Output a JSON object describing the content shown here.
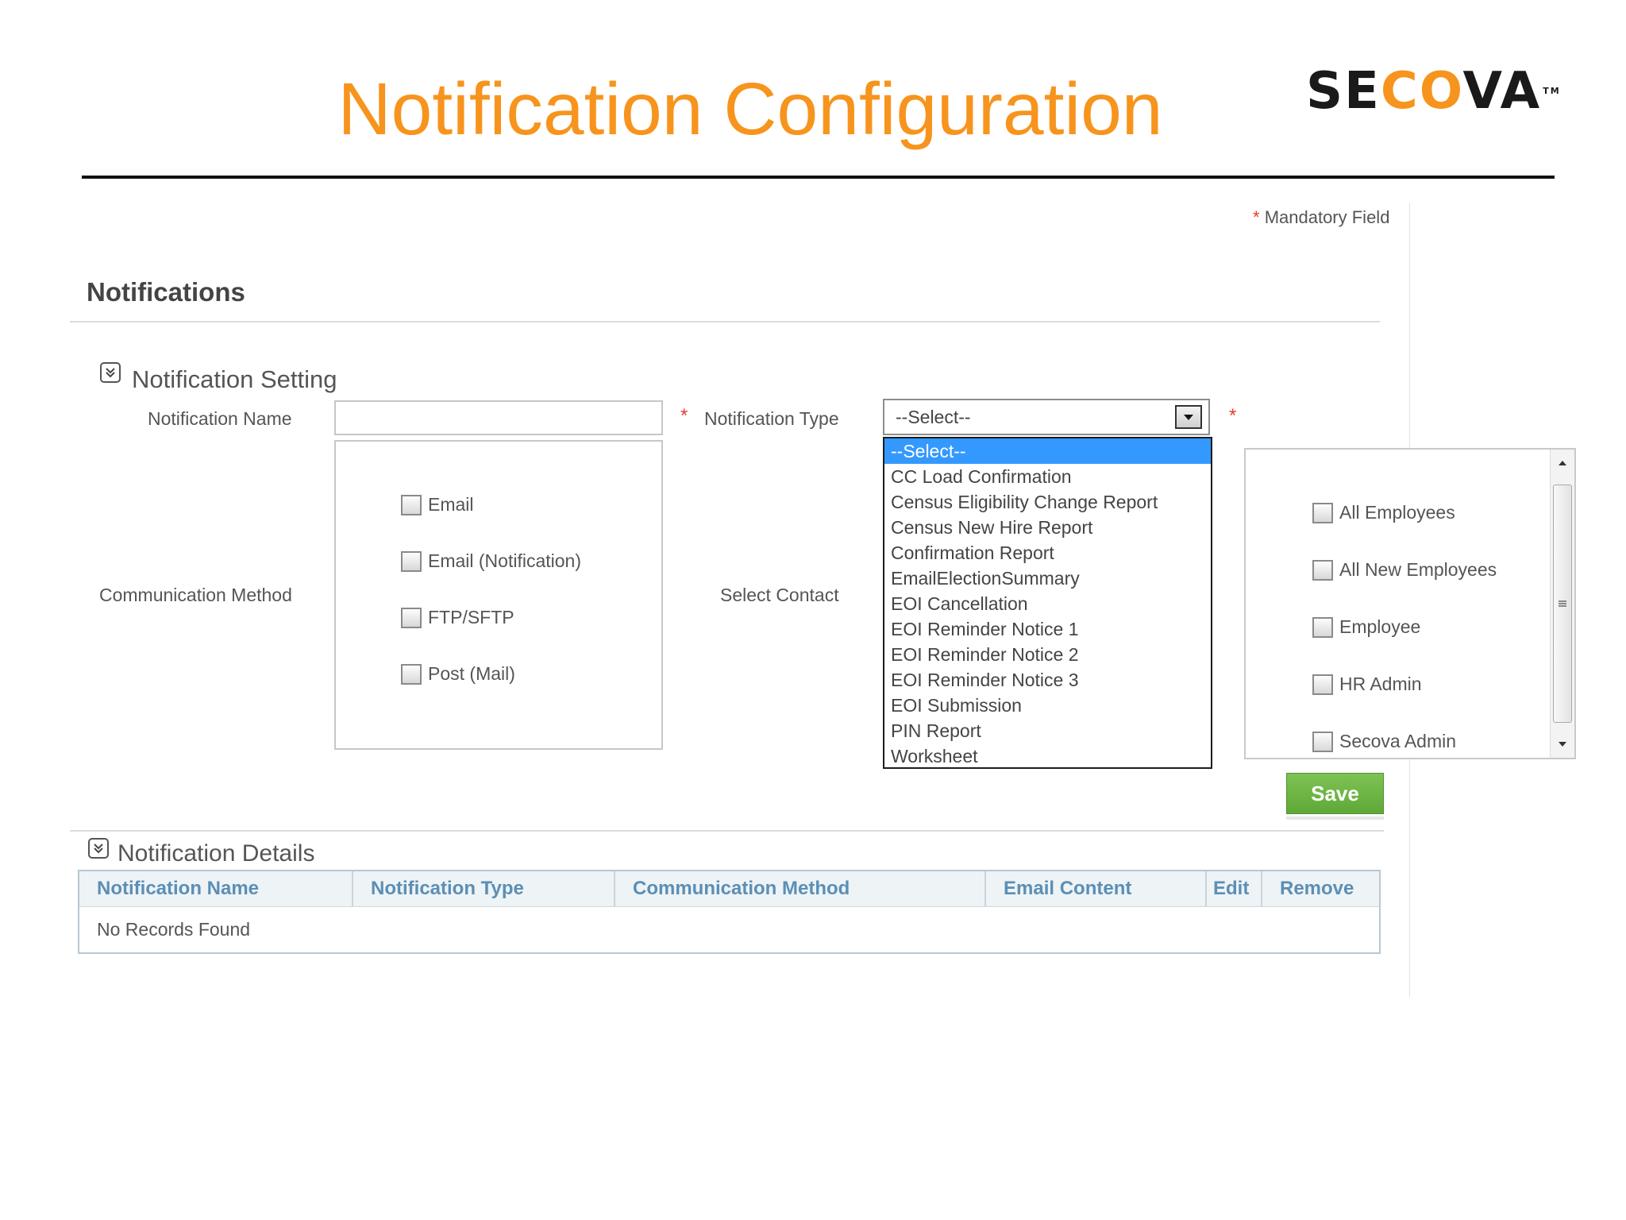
{
  "slide": {
    "title": "Notification Configuration",
    "logo_left": "SE",
    "logo_mid": "CO",
    "logo_right": "VA",
    "logo_tm": "TM"
  },
  "form": {
    "mandatory_star": "*",
    "mandatory_text": "Mandatory Field",
    "section_heading": "Notifications",
    "setting_title": "Notification Setting",
    "notification_name_label": "Notification Name",
    "notification_name_value": "",
    "notification_type_label": "Notification Type",
    "notification_type_value": "--Select--",
    "communication_method_label": "Communication Method",
    "select_contact_label": "Select Contact",
    "communication_methods": [
      "Email",
      "Email (Notification)",
      "FTP/SFTP",
      "Post (Mail)"
    ],
    "notification_type_options": [
      "--Select--",
      "CC Load Confirmation",
      "Census Eligibility Change Report",
      "Census New Hire Report",
      "Confirmation Report",
      "EmailElectionSummary",
      "EOI Cancellation",
      "EOI Reminder Notice 1",
      "EOI Reminder Notice 2",
      "EOI Reminder Notice 3",
      "EOI Submission",
      "PIN Report",
      "Worksheet"
    ],
    "selected_type_index": 0,
    "contacts": [
      "All Employees",
      "All New Employees",
      "Employee",
      "HR Admin",
      "Secova Admin"
    ],
    "save_label": "Save"
  },
  "details": {
    "title": "Notification Details",
    "columns": [
      "Notification Name",
      "Notification Type",
      "Communication Method",
      "Email Content",
      "Edit",
      "Remove"
    ],
    "empty_text": "No Records Found"
  },
  "colors": {
    "title_orange": "#f7941d",
    "selected_option": "#3399ff",
    "save_green": "#6db444",
    "header_link_blue": "#5b8fb5",
    "mandatory_red": "#e63b2e"
  }
}
